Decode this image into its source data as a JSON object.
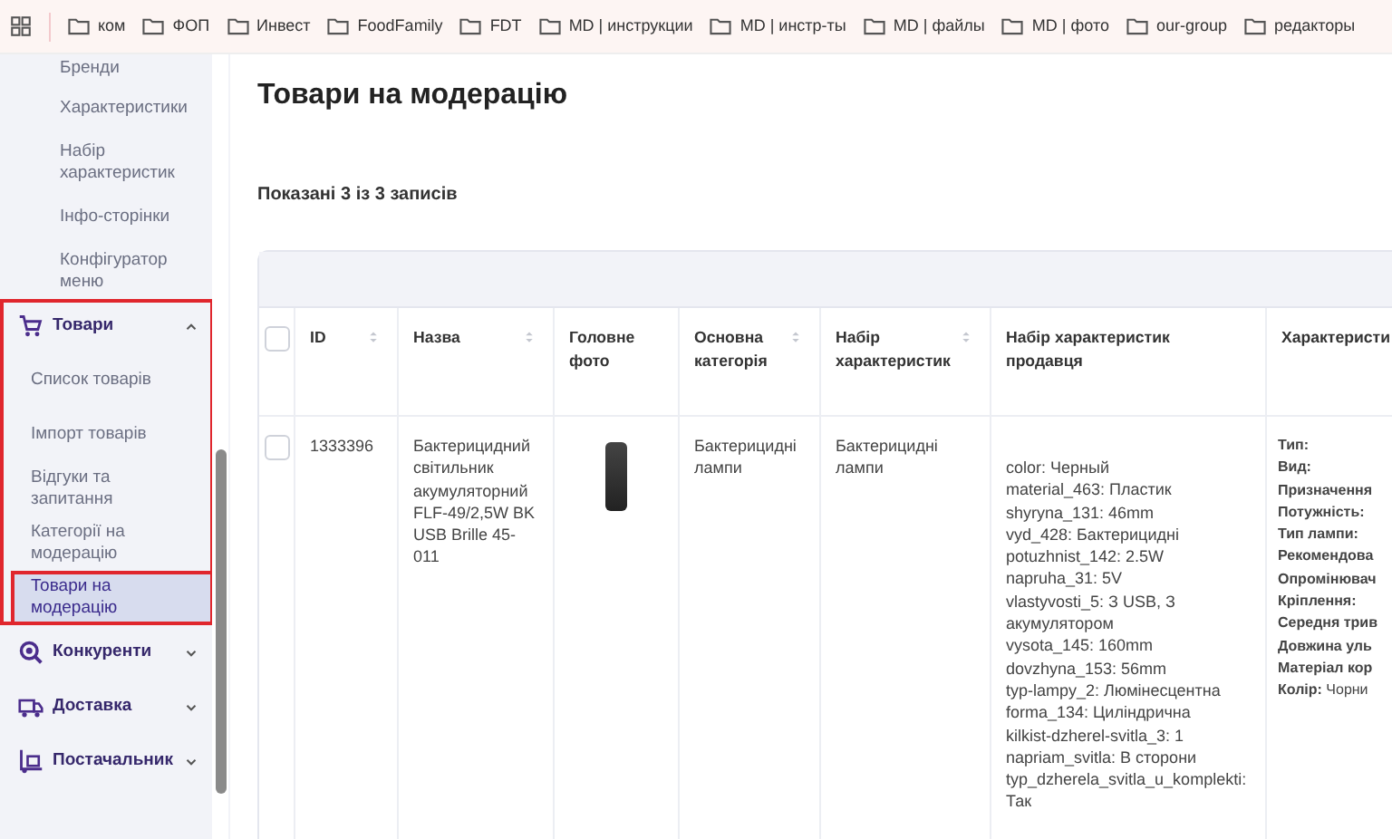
{
  "bookmarks": [
    "ком",
    "ФОП",
    "Инвест",
    "FoodFamily",
    "FDT",
    "MD | инструкции",
    "MD | инстр-ты",
    "MD | файлы",
    "MD | фото",
    "our-group",
    "редакторы"
  ],
  "sidebar": {
    "items": [
      {
        "kind": "sub",
        "label": "Бренди",
        "selected": false
      },
      {
        "kind": "sub",
        "label": "Характеристики",
        "selected": false
      },
      {
        "kind": "sub",
        "label": "Набір характеристик",
        "selected": false
      },
      {
        "kind": "sub",
        "label": "Інфо-сторінки",
        "selected": false
      },
      {
        "kind": "sub",
        "label": "Конфігуратор меню",
        "selected": false
      },
      {
        "kind": "group",
        "label": "Товари",
        "expanded": true,
        "highlighted": true,
        "children": [
          {
            "label": "Список товарів",
            "selected": false
          },
          {
            "label": "Імпорт товарів",
            "selected": false
          },
          {
            "label": "Відгуки та запитання",
            "selected": false
          },
          {
            "label": "Категорії на модерацію",
            "selected": false
          },
          {
            "label": "Товари на модерацію",
            "selected": true,
            "highlighted": true
          }
        ]
      },
      {
        "kind": "group",
        "label": "Конкуренти",
        "expanded": false
      },
      {
        "kind": "group",
        "label": "Доставка",
        "expanded": false
      },
      {
        "kind": "group",
        "label": "Постачальник",
        "expanded": false
      }
    ]
  },
  "page_title": "Товари на модерацію",
  "records_info": "Показані 3 із 3 записів",
  "table": {
    "select_all_checked": false,
    "columns": [
      {
        "label": "ID",
        "sortable": true
      },
      {
        "label": "Назва",
        "sortable": true
      },
      {
        "label": "Головне фото",
        "sortable": false
      },
      {
        "label": "Основна категорія",
        "sortable": true
      },
      {
        "label": "Набір характеристик",
        "sortable": true
      },
      {
        "label": "Набір характеристик продавця",
        "sortable": false
      },
      {
        "label": "Характеристи",
        "sortable": false
      }
    ],
    "rows": [
      {
        "checked": false,
        "id": "1333396",
        "name": "Бактерицидний світильник акумуляторний FLF-49/2,5W BK USB Brille 45-011",
        "category": "Бактерицидні лампи",
        "char_set": "Бактерицидні лампи",
        "seller_chars": [
          "color: Черный",
          "material_463: Пластик",
          "shyryna_131: 46mm",
          "vyd_428: Бактерицидні",
          "potuzhnist_142: 2.5W",
          "napruha_31: 5V",
          "vlastyvosti_5: З USB, З акумулятором",
          "vysota_145: 160mm",
          "dovzhyna_153: 56mm",
          "typ-lampy_2: Люмінесцентна",
          "forma_134: Циліндрична",
          "kilkist-dzherel-svitla_3: 1",
          "napriam_svitla: В сторони",
          "typ_dzherela_svitla_u_komplekti: Так"
        ],
        "chars": [
          {
            "label": "Тип:"
          },
          {
            "label": "Вид:"
          },
          {
            "label": "Призначення"
          },
          {
            "label": "Потужність:"
          },
          {
            "label": "Тип лампи:"
          },
          {
            "label": "Рекомендова"
          },
          {
            "label": "Опромінювач"
          },
          {
            "label": "Кріплення:"
          },
          {
            "label": "Середня трив"
          },
          {
            "label": "Довжина уль"
          },
          {
            "label": "Матеріал кор"
          },
          {
            "label": "Колір:",
            "value": "Чорни"
          }
        ]
      }
    ]
  }
}
